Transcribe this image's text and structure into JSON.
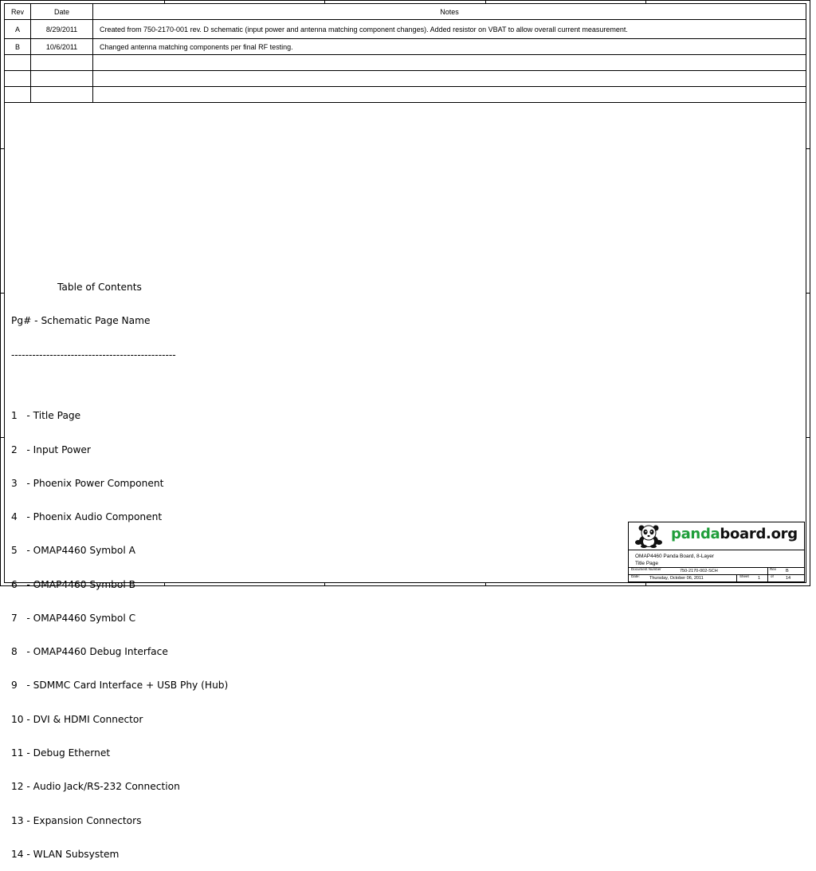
{
  "revision_table": {
    "headers": {
      "rev": "Rev",
      "date": "Date",
      "notes": "Notes"
    },
    "rows": [
      {
        "rev": "A",
        "date": "8/29/2011",
        "notes": "Created from 750-2170-001 rev. D schematic (input power and antenna matching component changes).  Added resistor on VBAT to allow overall current measurement."
      },
      {
        "rev": "B",
        "date": "10/6/2011",
        "notes": "Changed antenna matching components per final RF testing."
      },
      {
        "rev": "",
        "date": "",
        "notes": ""
      },
      {
        "rev": "",
        "date": "",
        "notes": ""
      },
      {
        "rev": "",
        "date": "",
        "notes": ""
      }
    ]
  },
  "toc": {
    "title": "Table of Contents",
    "subtitle": "Pg# - Schematic Page Name",
    "divider": "-----------------------------------------------",
    "items": [
      "1   - Title Page",
      "2   - Input Power",
      "3   - Phoenix Power Component",
      "4   - Phoenix Audio Component",
      "5   - OMAP4460 Symbol A",
      "6   - OMAP4460 Symbol B",
      "7   - OMAP4460 Symbol C",
      "8   - OMAP4460 Debug Interface",
      "9   - SDMMC Card Interface + USB Phy (Hub)",
      "10 - DVI & HDMI Connector",
      "11 - Debug Ethernet",
      "12 - Audio Jack/RS-232 Connection",
      "13 - Expansion Connectors",
      "14 - WLAN Subsystem"
    ]
  },
  "title_block": {
    "brand_green": "panda",
    "brand_dark": "board.org",
    "brand_color": "#1f9e3a",
    "logo_icon": "panda-icon",
    "title_line1": "OMAP4460 Panda Board, 8-Layer",
    "title_line2": "Title Page",
    "doc_number_label": "Document Number",
    "doc_number": "750-2170-002-SCH",
    "rev_label": "Rev",
    "rev": "B",
    "date_label": "Date:",
    "date": "Thursday, October 06, 2011",
    "sheet_label": "Sheet",
    "sheet": "1",
    "of_label": "of",
    "total": "14"
  }
}
